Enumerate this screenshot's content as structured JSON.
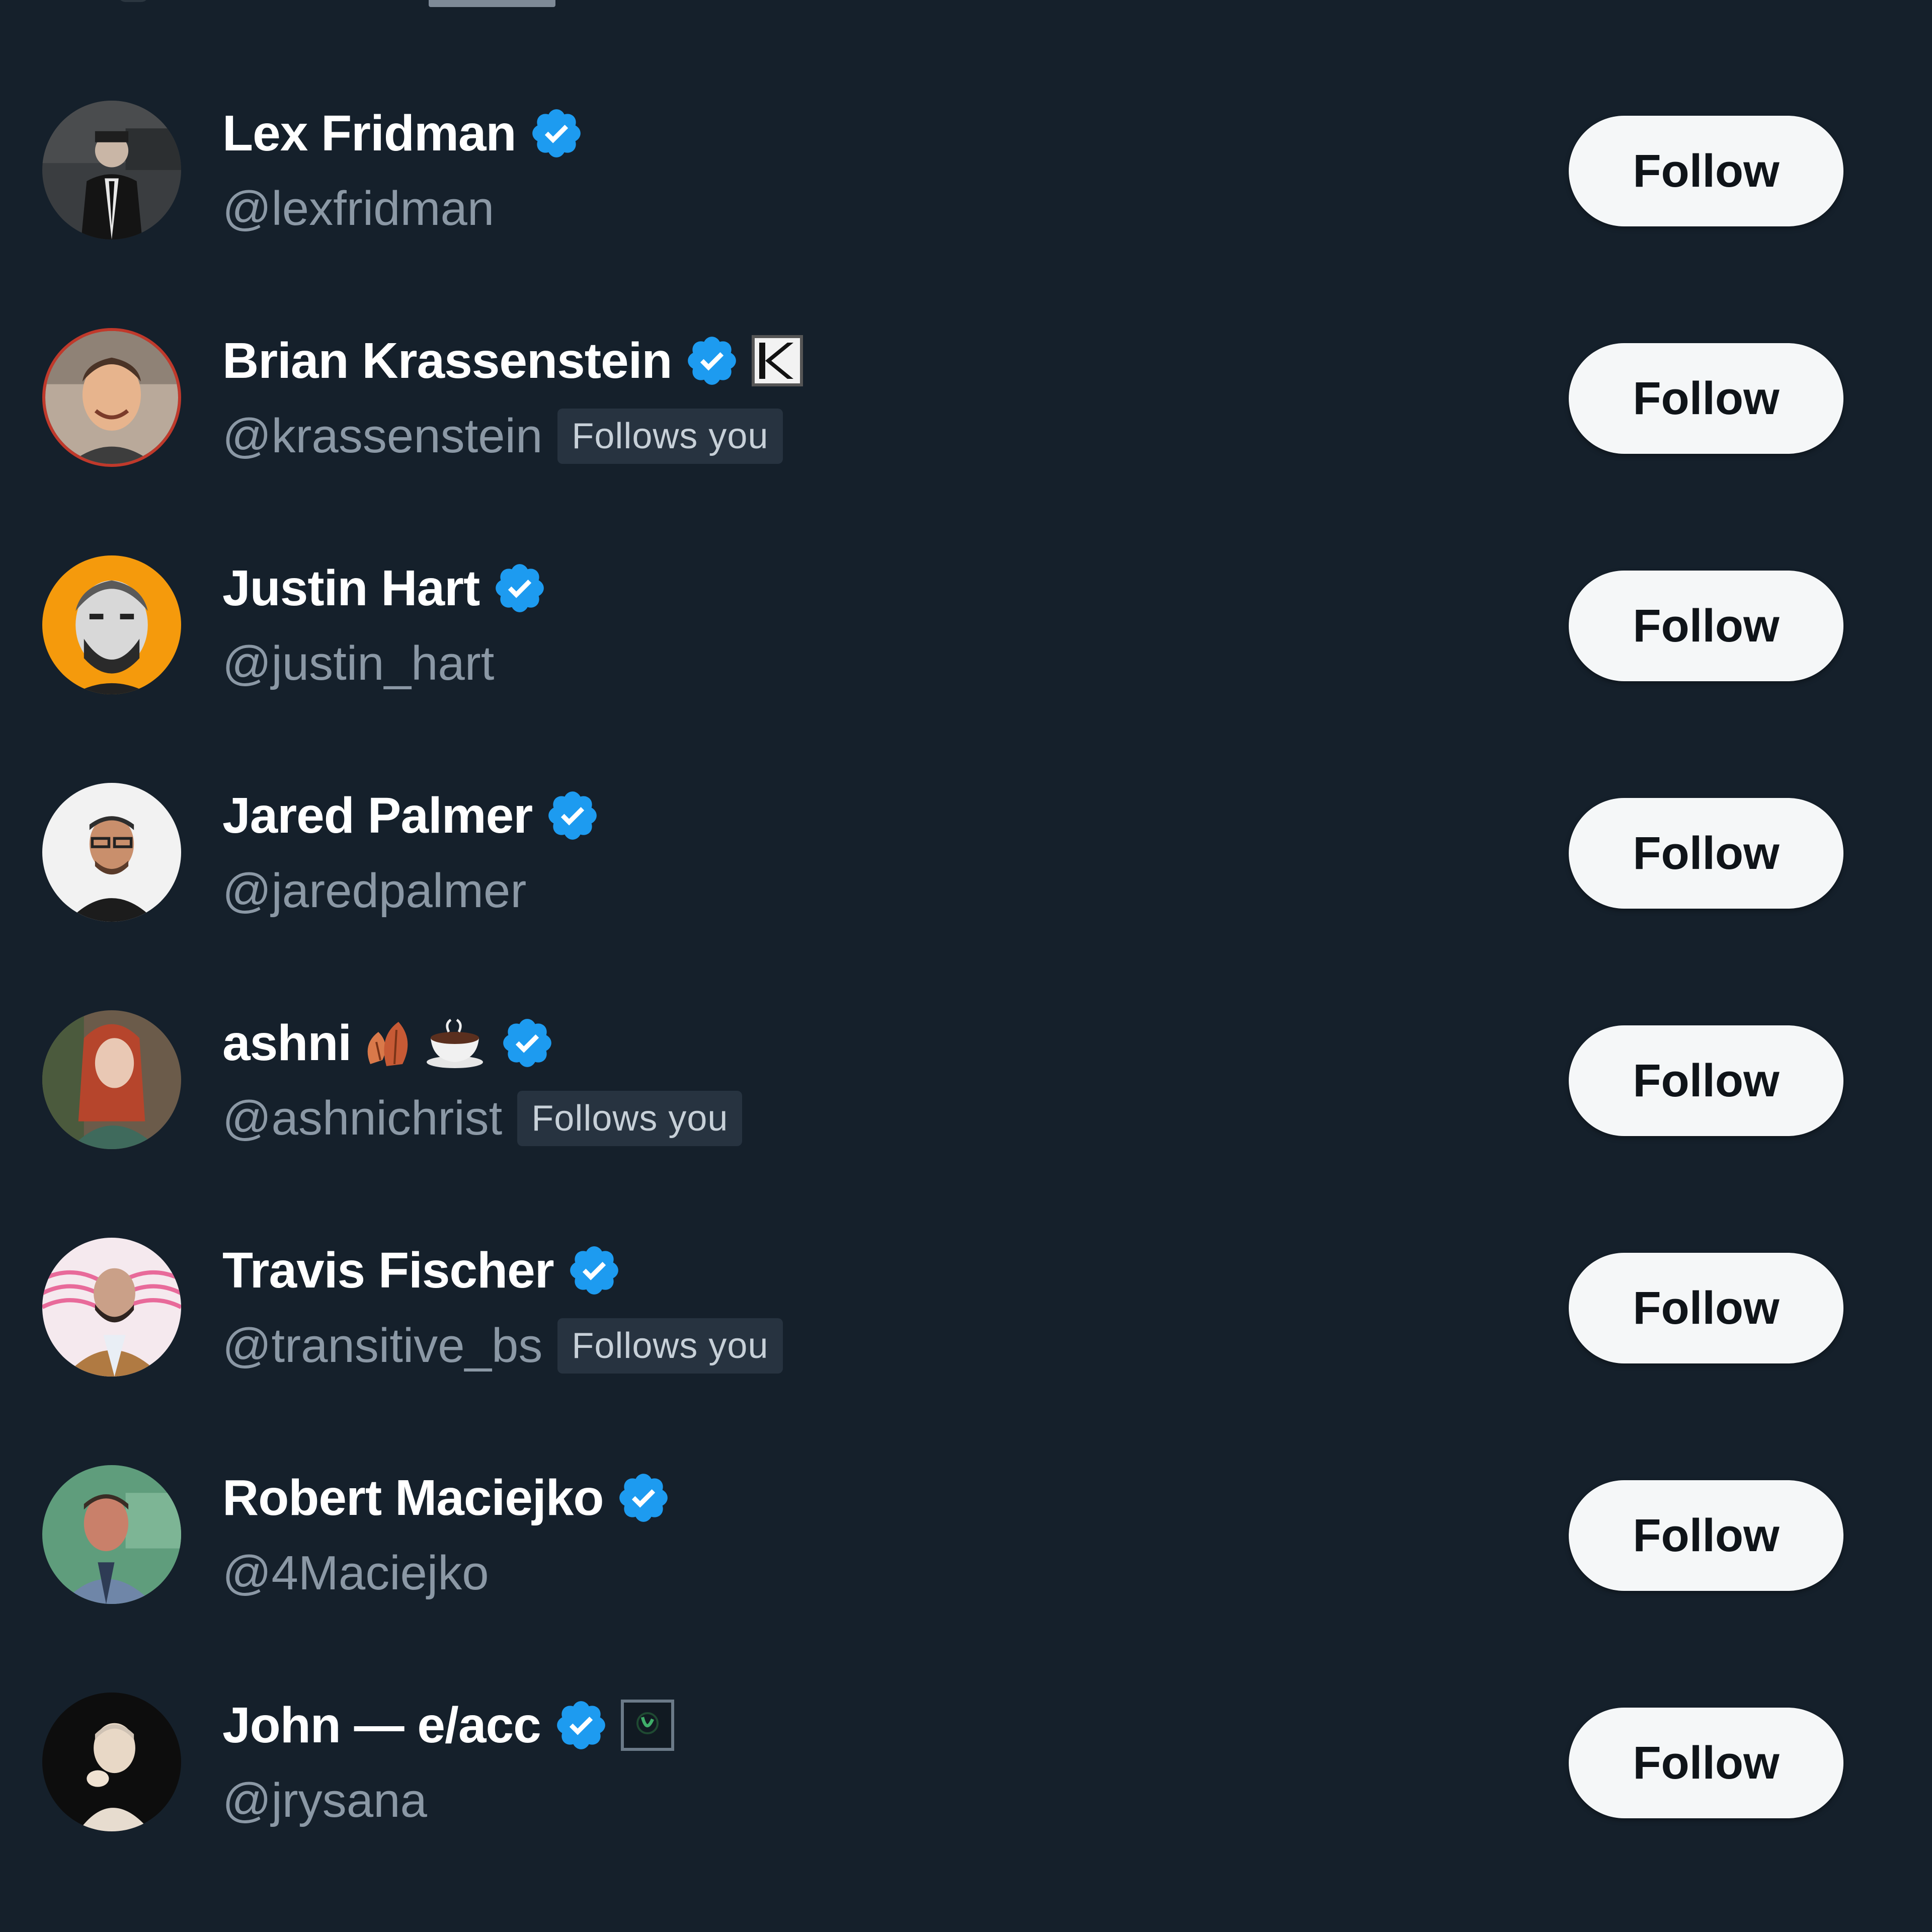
{
  "colors": {
    "background": "#15202b",
    "verified_blue": "#1d9bf0",
    "handle_gray": "#8b98a5",
    "button_bg": "#f5f7f8"
  },
  "follow_label": "Follow",
  "follows_you_label": "Follows you",
  "accounts": [
    {
      "name": "Lex Fridman",
      "handle": "@lexfridman",
      "verified": true,
      "follows_you": false,
      "avatar": "avatar-suit-man"
    },
    {
      "name": "Brian Krassenstein",
      "handle": "@krassenstein",
      "verified": true,
      "follows_you": true,
      "affiliate_badge": "K-logo",
      "avatar": "avatar-smiling-man"
    },
    {
      "name": "Justin Hart",
      "handle": "@justin_hart",
      "verified": true,
      "follows_you": false,
      "avatar": "avatar-bearded-man-orange"
    },
    {
      "name": "Jared Palmer",
      "handle": "@jaredpalmer",
      "verified": true,
      "follows_you": false,
      "avatar": "avatar-glasses-man"
    },
    {
      "name": "ashni",
      "emoji": "🍂☕",
      "handle": "@ashnichrist",
      "verified": true,
      "follows_you": true,
      "avatar": "avatar-red-hair-woman"
    },
    {
      "name": "Travis Fischer",
      "handle": "@transitive_bs",
      "verified": true,
      "follows_you": true,
      "avatar": "avatar-man-stripes"
    },
    {
      "name": "Robert Maciejko",
      "handle": "@4Maciejko",
      "verified": true,
      "follows_you": false,
      "avatar": "avatar-man-green"
    },
    {
      "name": "John — e/acc",
      "handle": "@jrysana",
      "verified": true,
      "follows_you": false,
      "affiliate_badge": "dark-square-logo",
      "avatar": "avatar-child-dark"
    }
  ]
}
